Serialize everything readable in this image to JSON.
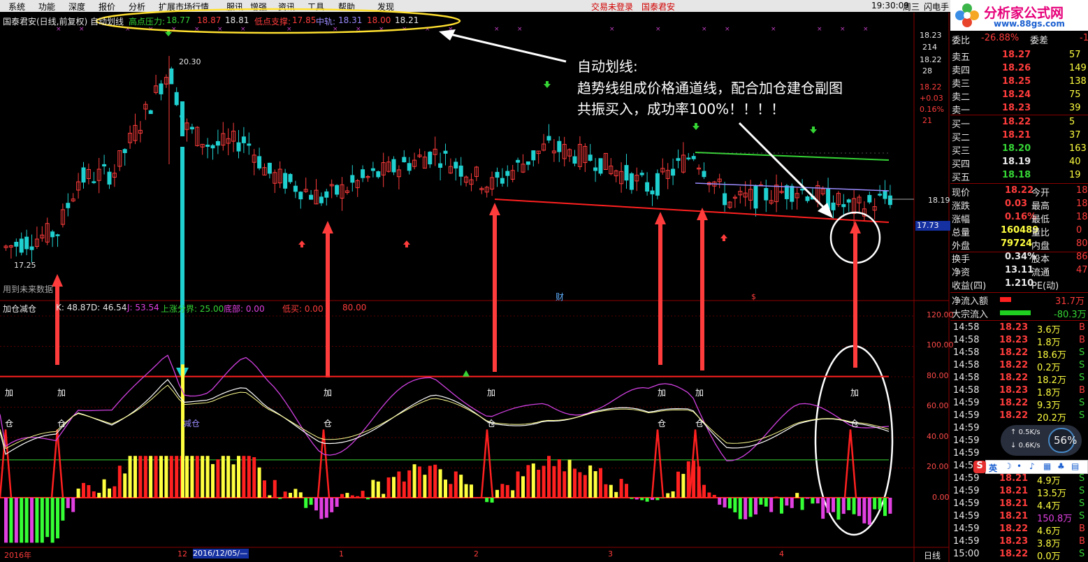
{
  "menu": {
    "items": [
      "系统",
      "功能",
      "深度",
      "报价",
      "分析",
      "扩展市场行情",
      "服讯",
      "增强",
      "资讯",
      "工具",
      "帮助",
      "发现"
    ],
    "login_status": "交易未登录",
    "broker": "国泰君安",
    "time": "19:30:09",
    "weekday": "周三",
    "flash": "闪电手"
  },
  "watermark": {
    "title": "分析家公式网",
    "url": "www.88gs.com"
  },
  "main_chart": {
    "title": "国泰君安(日线,前复权) 自动划线",
    "hi_label": "高点压力:",
    "hi_values": [
      "18.77",
      "18.87",
      "18.81"
    ],
    "lo_label": "低点支撑:",
    "lo_value": "17.85",
    "mid_label": "中轨:",
    "mid_values": [
      "18.31",
      "18.00",
      "18.21"
    ],
    "max_price": "20.30",
    "min_price": "17.25",
    "future_data": "用到未来数据",
    "cai": "财",
    "dollar": "$"
  },
  "annotation": {
    "line1": "自动划线:",
    "line2": "趋势线组成价格通道线，配合加仓建仓副图",
    "line3": "共振买入，成功率100%！！！！"
  },
  "right_axis": {
    "values": [
      "18.23",
      "214",
      "18.22",
      "28",
      "18.22",
      "+0.03",
      "0.16%",
      "21"
    ],
    "price_marker": "18.19",
    "current_box": "17.73"
  },
  "sub_chart": {
    "title": "加仓减仓",
    "k": "K: 48.87",
    "d": "D: 46.54",
    "j": "J: 53.54",
    "up_label": "上涨分界: 25.00",
    "bottom_label": "底部: 0.00",
    "low_buy": "低买: 0.00",
    "level80": "80.00",
    "axis": [
      "120.00",
      "100.00",
      "80.00",
      "60.00",
      "40.00",
      "20.00",
      "0.00"
    ],
    "add_label": "加",
    "cang_label": "仓",
    "reduce_label": "减仓"
  },
  "time_axis": {
    "labels": [
      "2016年",
      "12",
      "2016/12/05/—",
      "1",
      "2",
      "3",
      "4"
    ],
    "period": "日线"
  },
  "quote": {
    "ratio_label": "委比",
    "ratio_value": "-26.88%",
    "ratio_diff_label": "委差",
    "ratio_diff": "-1",
    "asks": [
      {
        "label": "卖五",
        "price": "18.27",
        "vol": "57"
      },
      {
        "label": "卖四",
        "price": "18.26",
        "vol": "149"
      },
      {
        "label": "卖三",
        "price": "18.25",
        "vol": "138"
      },
      {
        "label": "卖二",
        "price": "18.24",
        "vol": "75"
      },
      {
        "label": "卖一",
        "price": "18.23",
        "vol": "39"
      }
    ],
    "bids": [
      {
        "label": "买一",
        "price": "18.22",
        "vol": "5"
      },
      {
        "label": "买二",
        "price": "18.21",
        "vol": "37"
      },
      {
        "label": "买三",
        "price": "18.20",
        "vol": "163"
      },
      {
        "label": "买四",
        "price": "18.19",
        "vol": "40"
      },
      {
        "label": "买五",
        "price": "18.18",
        "vol": "19"
      }
    ],
    "stats": [
      {
        "l1": "现价",
        "v1": "18.22",
        "l2": "今开",
        "v2": "18"
      },
      {
        "l1": "涨跌",
        "v1": "0.03",
        "l2": "最高",
        "v2": "18"
      },
      {
        "l1": "涨幅",
        "v1": "0.16%",
        "l2": "最低",
        "v2": "18"
      },
      {
        "l1": "总量",
        "v1": "160489",
        "l2": "量比",
        "v2": "0"
      },
      {
        "l1": "外盘",
        "v1": "79724",
        "l2": "内盘",
        "v2": "80"
      },
      {
        "l1": "换手",
        "v1": "0.34%",
        "l2": "股本",
        "v2": "86"
      },
      {
        "l1": "净资",
        "v1": "13.11",
        "l2": "流通",
        "v2": "47"
      },
      {
        "l1": "收益(四)",
        "v1": "1.210",
        "l2": "PE(动)",
        "v2": ""
      }
    ],
    "net_inflow_label": "净流入额",
    "net_inflow": "31.7万",
    "big_inflow_label": "大宗流入",
    "big_inflow": "-80.3万"
  },
  "ticks": [
    {
      "t": "14:58",
      "p": "18.23",
      "v": "3.6万",
      "d": "B"
    },
    {
      "t": "14:58",
      "p": "18.23",
      "v": "1.8万",
      "d": "B"
    },
    {
      "t": "14:58",
      "p": "18.22",
      "v": "18.6万",
      "d": "S"
    },
    {
      "t": "14:58",
      "p": "18.22",
      "v": "0.2万",
      "d": "S"
    },
    {
      "t": "14:58",
      "p": "18.22",
      "v": "18.2万",
      "d": "S"
    },
    {
      "t": "14:58",
      "p": "18.23",
      "v": "1.8万",
      "d": "B"
    },
    {
      "t": "14:59",
      "p": "18.22",
      "v": "9.3万",
      "d": "S"
    },
    {
      "t": "14:59",
      "p": "18.22",
      "v": "20.2万",
      "d": "S"
    },
    {
      "t": "14:59",
      "p": "",
      "v": "",
      "d": ""
    },
    {
      "t": "14:59",
      "p": "",
      "v": "",
      "d": ""
    },
    {
      "t": "14:59",
      "p": "",
      "v": "",
      "d": ""
    },
    {
      "t": "14:59",
      "p": "",
      "v": "",
      "d": ""
    },
    {
      "t": "14:59",
      "p": "18.21",
      "v": "4.9万",
      "d": "S"
    },
    {
      "t": "14:59",
      "p": "18.21",
      "v": "13.5万",
      "d": "S"
    },
    {
      "t": "14:59",
      "p": "18.21",
      "v": "4.4万",
      "d": "S"
    },
    {
      "t": "14:59",
      "p": "18.21",
      "v": "150.8万",
      "d": "S"
    },
    {
      "t": "14:59",
      "p": "18.22",
      "v": "4.6万",
      "d": "B"
    },
    {
      "t": "14:59",
      "p": "18.23",
      "v": "3.8万",
      "d": "B"
    },
    {
      "t": "15:00",
      "p": "18.22",
      "v": "0.0万",
      "d": "S"
    }
  ],
  "net_widget": {
    "up": "0.5K/s",
    "down": "0.6K/s",
    "pct": "56%"
  },
  "ime": {
    "label": "英"
  },
  "colors": {
    "up": "#ff3c3c",
    "down": "#20d0d0",
    "bg": "#000000",
    "grid": "#8b0000"
  }
}
